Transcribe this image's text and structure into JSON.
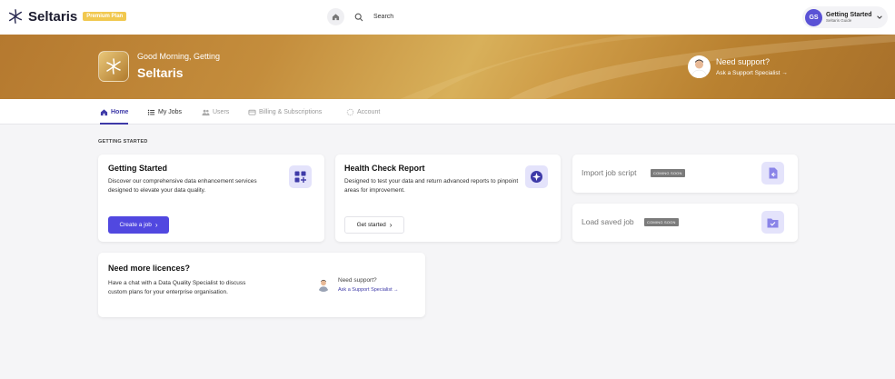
{
  "topbar": {
    "brand": "Seltaris",
    "badge": "Premium Plan",
    "search_placeholder": "Search",
    "user_initials": "GS",
    "user_name": "Getting Started",
    "user_org": "Seltaris Guide"
  },
  "banner": {
    "greeting": "Good Morning, Getting",
    "title": "Seltaris",
    "support_question": "Need support?",
    "support_link": "Ask a Support Specialist →"
  },
  "tabs": [
    {
      "label": "Home",
      "icon": "home-icon",
      "state": "active"
    },
    {
      "label": "My Jobs",
      "icon": "list-icon",
      "state": "normal"
    },
    {
      "label": "Users",
      "icon": "users-icon",
      "state": "disabled"
    },
    {
      "label": "Billing & Subscriptions",
      "icon": "billing-icon",
      "state": "disabled"
    },
    {
      "label": "Account",
      "icon": "account-icon",
      "state": "disabled"
    }
  ],
  "section_label": "GETTING STARTED",
  "cards": {
    "getting_started": {
      "title": "Getting Started",
      "description": "Discover our comprehensive data enhancement services designed to elevate your data quality.",
      "button": "Create a job",
      "icon": "grid-plus-icon"
    },
    "health_check": {
      "title": "Health Check Report",
      "description": "Designed to test your data and return advanced reports to pinpoint areas for improvement.",
      "button": "Get started",
      "icon": "health-check-icon"
    },
    "import_job": {
      "title": "Import job script",
      "badge": "COMING SOON",
      "icon": "import-file-icon"
    },
    "load_job": {
      "title": "Load saved job",
      "badge": "COMING SOON",
      "icon": "folder-check-icon"
    },
    "licences": {
      "title": "Need more licences?",
      "description": "Have a chat with a Data Quality Specialist to discuss custom plans for your enterprise organisation.",
      "support_question": "Need support?",
      "support_link": "Ask a Support Specialist →"
    }
  },
  "colors": {
    "accent": "#5148e0",
    "premium_badge": "#f1c84f",
    "banner": "#c48d3c"
  }
}
